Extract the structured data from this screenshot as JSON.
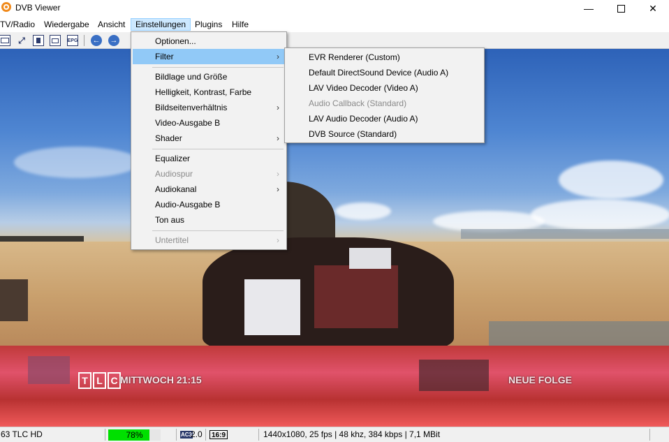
{
  "window": {
    "title": "DVB Viewer",
    "minimize_icon": "minimize-icon",
    "maximize_icon": "maximize-icon",
    "close_icon": "close-icon"
  },
  "menubar": [
    "TV/Radio",
    "Wiedergabe",
    "Ansicht",
    "Einstellungen",
    "Plugins",
    "Hilfe"
  ],
  "toolbar": {
    "epg_label": "EPG",
    "back_icon": "arrow-left-icon",
    "forward_icon": "arrow-right-icon"
  },
  "video_overlay": {
    "logo_letters": [
      "T",
      "L",
      "C"
    ],
    "schedule": "MITTWOCH 21:15",
    "badge": "NEUE FOLGE"
  },
  "dropdown": {
    "items": [
      {
        "label": "Optionen...",
        "submenu": false,
        "disabled": false
      },
      {
        "label": "Filter",
        "submenu": true,
        "disabled": false,
        "highlighted": true
      },
      {
        "label": "Bildlage und Größe",
        "submenu": false,
        "disabled": false
      },
      {
        "label": "Helligkeit, Kontrast, Farbe",
        "submenu": false,
        "disabled": false
      },
      {
        "label": "Bildseitenverhältnis",
        "submenu": true,
        "disabled": false
      },
      {
        "label": "Video-Ausgabe B",
        "submenu": false,
        "disabled": false
      },
      {
        "label": "Shader",
        "submenu": true,
        "disabled": false
      },
      {
        "label": "Equalizer",
        "submenu": false,
        "disabled": false
      },
      {
        "label": "Audiospur",
        "submenu": true,
        "disabled": true
      },
      {
        "label": "Audiokanal",
        "submenu": true,
        "disabled": false
      },
      {
        "label": "Audio-Ausgabe B",
        "submenu": false,
        "disabled": false
      },
      {
        "label": "Ton aus",
        "submenu": false,
        "disabled": false
      },
      {
        "label": "Untertitel",
        "submenu": true,
        "disabled": true
      }
    ]
  },
  "submenu": {
    "items": [
      {
        "label": "EVR Renderer (Custom)",
        "disabled": false
      },
      {
        "label": "Default DirectSound Device (Audio A)",
        "disabled": false
      },
      {
        "label": "LAV Video Decoder (Video A)",
        "disabled": false
      },
      {
        "label": "Audio Callback (Standard)",
        "disabled": true
      },
      {
        "label": "LAV Audio Decoder (Audio A)",
        "disabled": false
      },
      {
        "label": "DVB Source (Standard)",
        "disabled": false
      }
    ]
  },
  "statusbar": {
    "channel": "63 TLC HD",
    "signal_percent": 78,
    "signal_label": "78%",
    "audio_badge": "AC3",
    "audio_channels": "2.0",
    "aspect": "16:9",
    "stream_info": "1440x1080, 25 fps | 48 khz, 384 kbps | 7,1 MBit"
  },
  "colors": {
    "highlight": "#91c9f7",
    "menu_active": "#cce8ff",
    "signal": "#00e000"
  }
}
